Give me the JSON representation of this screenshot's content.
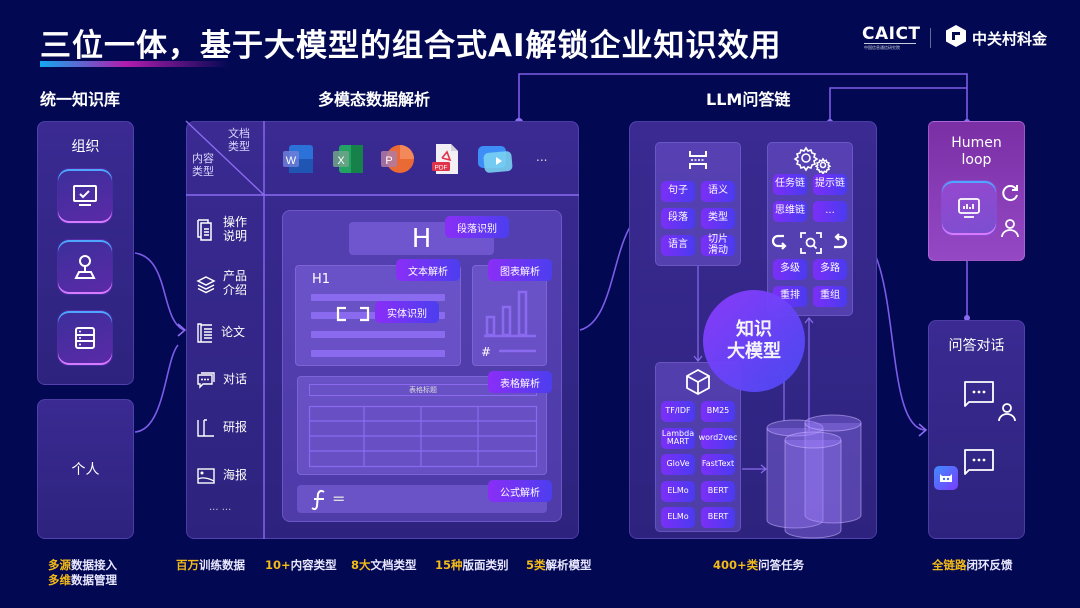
{
  "header": {
    "title": "三位一体，基于大模型的组合式AI解锁企业知识效用",
    "logos": {
      "caict": "CAICT",
      "caict_sub": "中国信息通信研究院",
      "zgc": "中关村科金"
    }
  },
  "sections": {
    "kb": "统一知识库",
    "parse": "多模态数据解析",
    "llm": "LLM问答链"
  },
  "knowledge_base": {
    "org_label": "组织",
    "org_icons": [
      "monitor-check-icon",
      "person-pin-icon",
      "server-icon"
    ],
    "personal_label": "个人"
  },
  "parsing": {
    "header_doc_type": "文档\n类型",
    "header_content_type": "内容\n类型",
    "doc_types": [
      "word-icon",
      "excel-icon",
      "powerpoint-icon",
      "pdf-icon",
      "video-icon"
    ],
    "doc_more": "...",
    "content_types": [
      {
        "label": "操作\n说明",
        "icon": "document-stack-icon"
      },
      {
        "label": "产品\n介绍",
        "icon": "layers-icon"
      },
      {
        "label": "论文",
        "icon": "paper-icon"
      },
      {
        "label": "对话",
        "icon": "chat-icon"
      },
      {
        "label": "研报",
        "icon": "report-icon"
      },
      {
        "label": "海报",
        "icon": "image-icon"
      }
    ],
    "content_more": "··· ···",
    "tags": {
      "paragraph": "段落识别",
      "text": "文本解析",
      "chart": "图表解析",
      "entity": "实体识别",
      "table": "表格解析",
      "formula": "公式解析"
    },
    "heading_glyph": "H",
    "h1_glyph": "H1",
    "table_title": "表格标题",
    "hash_glyph": "#",
    "formula_glyph": "=",
    "table_rows": 4,
    "table_cols": 4
  },
  "llm_chain": {
    "split_chips": [
      "句子",
      "语义",
      "段落",
      "类型",
      "语言",
      "切片\n滑动"
    ],
    "chain_chips": [
      "任务链",
      "提示链",
      "思维链",
      "..."
    ],
    "retrieval_chips": [
      "多级",
      "多路",
      "重排",
      "重组"
    ],
    "center_label": "知识\n大模型",
    "model_chips": [
      "TF/IDF",
      "BM25",
      "Lambda\nMART",
      "word2vec",
      "GloVe",
      "FastText",
      "ELMo",
      "BERT",
      "ELMo",
      "BERT"
    ]
  },
  "right": {
    "human_loop": "Humen\nloop",
    "qa_title": "问答对话"
  },
  "footer": [
    {
      "hl": "多源",
      "text": "数据接入"
    },
    {
      "hl": "多维",
      "text": "数据管理"
    },
    {
      "hl": "百万",
      "text": "训练数据"
    },
    {
      "hl": "10+",
      "text": "内容类型"
    },
    {
      "hl": "8大",
      "text": "文档类型"
    },
    {
      "hl": "15种",
      "text": "版面类别"
    },
    {
      "hl": "5类",
      "text": "解析模型"
    },
    {
      "hl": "400+类",
      "text": "问答任务"
    },
    {
      "hl": "全链路",
      "text": "闭环反馈"
    }
  ],
  "colors": {
    "bg": "#020852",
    "accent": "#f3bb17",
    "chip": "#7b2ff7",
    "line": "#8a6bf0"
  }
}
